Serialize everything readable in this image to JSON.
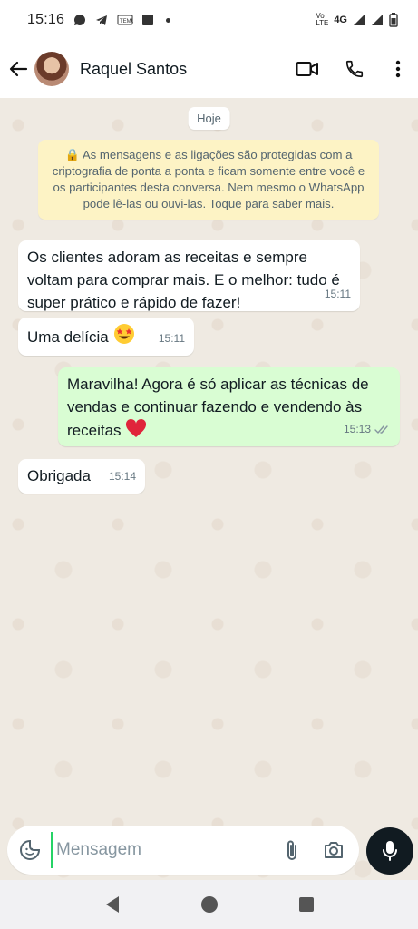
{
  "status_bar": {
    "time": "15:16",
    "network": "4G",
    "volte": "Vo LTE"
  },
  "header": {
    "contact_name": "Raquel Santos"
  },
  "chat": {
    "date_chip": "Hoje",
    "encryption_notice": "🔒 As mensagens e as ligações são protegidas com a criptografia de ponta a ponta e ficam somente entre você e os participantes desta conversa. Nem mesmo o WhatsApp pode lê-las ou ouvi-las. Toque para saber mais.",
    "messages": [
      {
        "direction": "in",
        "text": "Os clientes adoram as receitas e sempre voltam para comprar mais. E o melhor: tudo é super prático e rápido de fazer!",
        "time": "15:11"
      },
      {
        "direction": "in",
        "text": "Uma delícia",
        "emoji": "star-struck",
        "time": "15:11"
      },
      {
        "direction": "out",
        "text": "Maravilha! Agora é só aplicar as técnicas de vendas e continuar fazendo e vendendo às receitas",
        "emoji": "red-heart",
        "time": "15:13",
        "status": "read"
      },
      {
        "direction": "in",
        "text": "Obrigada",
        "time": "15:14"
      }
    ]
  },
  "composer": {
    "placeholder": "Mensagem",
    "value": ""
  },
  "colors": {
    "chat_bg": "#efeae2",
    "incoming_bubble": "#ffffff",
    "outgoing_bubble": "#d9fdd3",
    "encryption_bg": "#fdf3c5",
    "mic_button": "#111b21"
  },
  "icons": [
    "back-arrow-icon",
    "video-call-icon",
    "phone-icon",
    "more-options-icon",
    "sticker-icon",
    "attach-icon",
    "camera-icon",
    "mic-icon",
    "nav-back-icon",
    "nav-home-icon",
    "nav-recents-icon"
  ]
}
